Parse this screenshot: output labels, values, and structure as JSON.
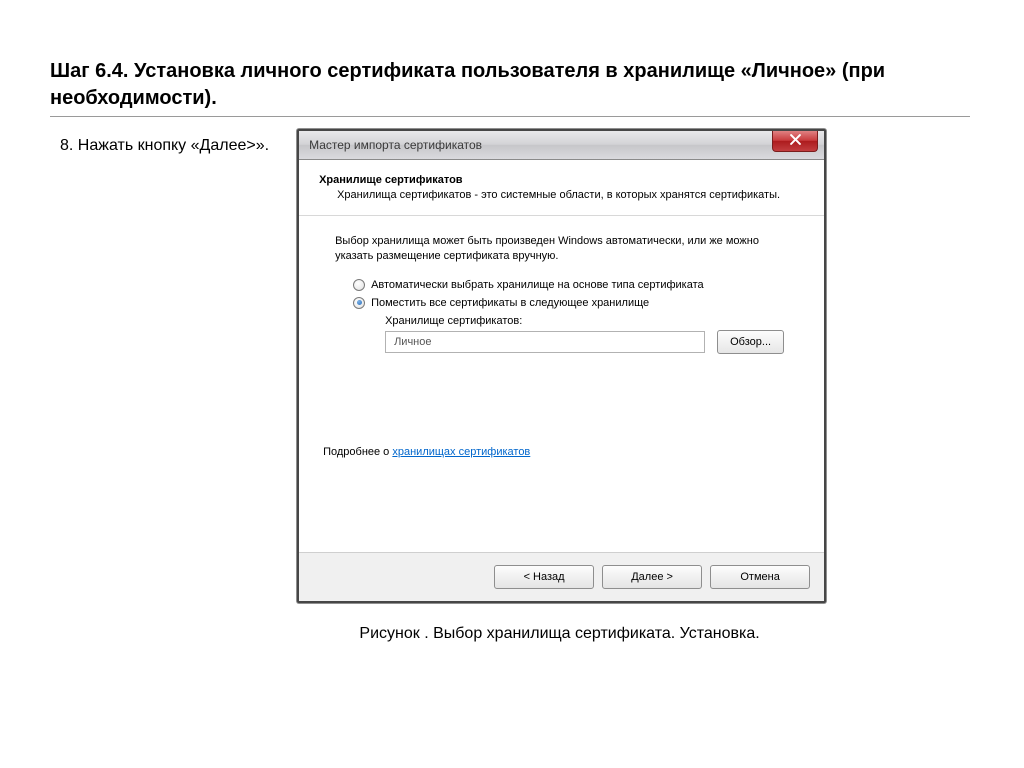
{
  "heading": "Шаг 6.4. Установка личного сертификата пользователя в хранилище «Личное» (при необходимости).",
  "instruction": "8. Нажать кнопку «Далее>».",
  "caption": "Рисунок . Выбор хранилища сертификата. Установка.",
  "wizard": {
    "title": "Мастер импорта сертификатов",
    "section_title": "Хранилище сертификатов",
    "section_desc": "Хранилища сертификатов - это системные области, в которых хранятся сертификаты.",
    "paragraph": "Выбор хранилища может быть произведен Windows автоматически, или же можно указать размещение сертификата вручную.",
    "radio_auto": "Автоматически выбрать хранилище на основе типа сертификата",
    "radio_manual": "Поместить все сертификаты в следующее хранилище",
    "store_label": "Хранилище сертификатов:",
    "store_value": "Личное",
    "browse": "Обзор...",
    "more_prefix": "Подробнее о ",
    "more_link": "хранилищах сертификатов",
    "back": "< Назад",
    "next": "Далее >",
    "cancel": "Отмена"
  }
}
